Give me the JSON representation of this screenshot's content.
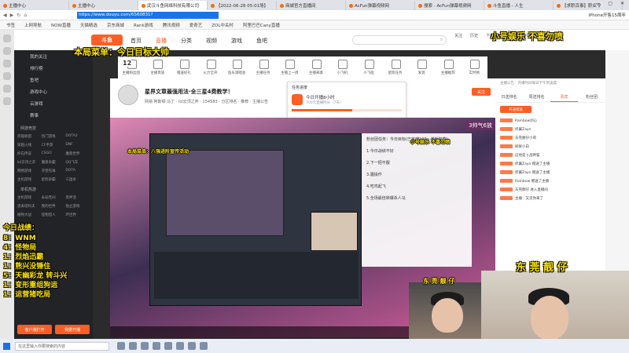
{
  "browser": {
    "tabs": [
      {
        "title": "主播中心"
      },
      {
        "title": "主播中心"
      },
      {
        "title": "武汉斗鱼网络科技有限公司"
      },
      {
        "title": "【2022-06-28 05:01场】"
      },
      {
        "title": "商城官方直播间"
      },
      {
        "title": "AcFun弹幕视频网"
      },
      {
        "title": "搜索 - AcFun弹幕视频网"
      },
      {
        "title": "斗鱼直播 - 人生"
      },
      {
        "title": "【求职百事】职业令"
      },
      {
        "title": "【求职百事】职业令人"
      }
    ],
    "url": "https://www.douyu.com/6560831?",
    "addr_right": "iPhone开售15周年",
    "bookmarks": [
      "书签",
      "上网导航",
      "NOW直播",
      "天猫精选",
      "京东商城",
      "Rank游戏",
      "腾讯视频",
      "爱奇艺",
      "ZOL中关村",
      "阿里巴巴Cany直播"
    ]
  },
  "site": {
    "logo": "斗鱼",
    "nav": [
      "首页",
      "直播",
      "分类",
      "视频",
      "游戏",
      "鱼吧"
    ],
    "search_placeholder": "",
    "header_icons": [
      "关注",
      "历史",
      "下载",
      "消息",
      "创作中心"
    ]
  },
  "sidebar": {
    "items": [
      "我的关注",
      "排行榜",
      "鱼吧",
      "游戏中心",
      "云游戏",
      "赛事"
    ],
    "section1": "网游竞技",
    "grid1": [
      "英雄联盟",
      "热门游戏",
      "DOTA2",
      "穿越火线",
      "CF手游",
      "DNF",
      "炉石传说",
      "CSGO",
      "魔兽世界",
      "lol云顶之弈",
      "魔兽争霸",
      "QQ飞车",
      "网络游戏",
      "守望先锋",
      "DOTA",
      "主机游戏",
      "星际争霸",
      "三国杀"
    ],
    "section2": "单机热游",
    "grid2": [
      "主机游戏",
      "永劫无间",
      "黑神话",
      "逃离塔科夫",
      "我的世界",
      "独立游戏",
      "植物大战",
      "怪物猎人",
      "环世界"
    ],
    "btn_open": "客户端打开",
    "btn_live": "我要开播"
  },
  "task_icons": [
    "主播粉丝团",
    "主播贵族",
    "赠送好礼",
    "火力全开",
    "鱼乐演唱会",
    "主播任务",
    "主播上一周",
    "主播来袭",
    "小飞机",
    "小飞船",
    "星际任务",
    "发现",
    "主播推荐",
    "实时榜"
  ],
  "fan_count": "12",
  "streamer": {
    "title": "星界文章最强用法·全三星4费教学！",
    "sub": "网易·阿斯顿·马丁 · lol云顶之弈 · 154583 · 分区排名 · 推荐 · 主播公告",
    "follow": "关注"
  },
  "popup": {
    "title": "任务进度",
    "line1": "今日开播8小时",
    "line2": "700元直播时长（7天）",
    "progress": 0.55
  },
  "video": {
    "chat_lines": [
      "粉丝团任务：今日目标(已完成100，老板加菜)",
      "1.今日战绩不好",
      "2.下一把不服",
      "3.骚操作",
      "4.吃鸡起飞",
      "5.全场最佳转爆杀人马"
    ],
    "banner": "3帅气6放",
    "inner_title": "小号娱乐 · 不喜勿喷"
  },
  "rightpanel": {
    "tabs": [
      "日送排名",
      "周送排名",
      "贵宾",
      "粉丝团"
    ],
    "top_note": "主播公告：开播时间每日下午到凌晨",
    "open_btn": "开通贵族",
    "ranks": [
      "Rainbow剑心",
      "折翼Zayn",
      "东莞靓仔小哥",
      "刷屏小白",
      "这他是卜战神猫",
      "折翼Zayn 赠送了主播",
      "折翼Zayn 赠送了主播",
      "Rainbow 赠送了主播",
      "东莞靓仔 进入直播间",
      "主播：又见你来了"
    ]
  },
  "overlays": {
    "top_menu": "本局菜单：今日目标大帅",
    "top_right": "小号娱乐  不喜勿喷",
    "inner_menu": "本局菜单：八强进阶宣传活动",
    "inner_right": "小号娱乐  不喜勿喷",
    "tonight_title": "今日战绩：",
    "tonight_lines": [
      "8：WNM",
      "4：怪物局",
      "1：烈焰迅霸",
      "1：熊兴没锤住",
      "5：天幽彩龙 转斗兴",
      "1：变形重组狗运",
      "1：运营猪吃局"
    ],
    "dongguan": "东  莞  靓  仔",
    "dongguan_small": "东  莞  靓  仔"
  },
  "windows": {
    "search": "在这里输入你要搜索的内容"
  }
}
